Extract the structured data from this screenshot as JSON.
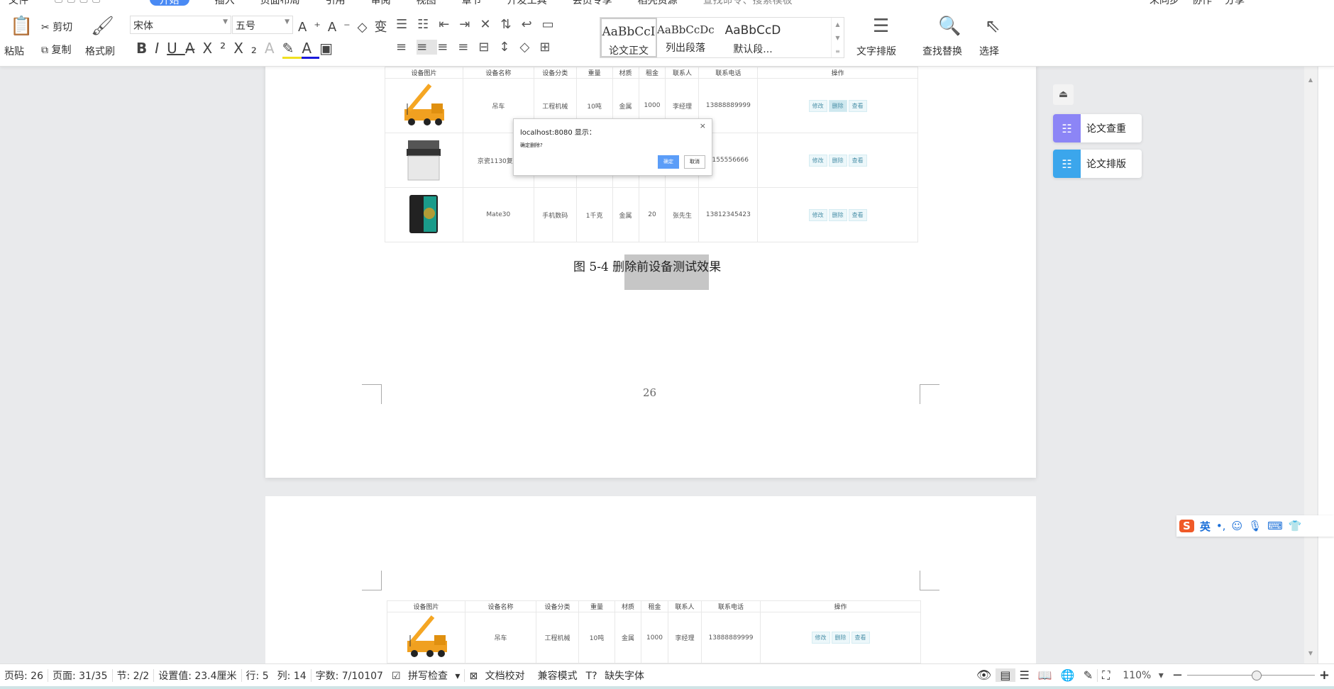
{
  "ribbon": {
    "tabs": [
      "文件",
      "开始",
      "插入",
      "页面布局",
      "引用",
      "审阅",
      "视图",
      "章节",
      "开发工具",
      "会员专享",
      "稻壳资源"
    ],
    "active_tab": "开始",
    "search_placeholder": "查找命令、搜索模板",
    "right": [
      "未同步",
      "协作",
      "分享"
    ],
    "clipboard": {
      "paste": "粘贴",
      "cut": "剪切",
      "copy": "复制",
      "format_painter": "格式刷"
    },
    "font": {
      "family": "宋体",
      "size": "五号"
    },
    "styles": [
      {
        "preview": "AaBbCcI",
        "label": "论文正文"
      },
      {
        "preview": "AaBbCcDc",
        "label": "列出段落"
      },
      {
        "preview": "AaBbCcD",
        "label": "默认段..."
      }
    ],
    "text_layout": "文字排版",
    "find_replace": "查找替换",
    "select": "选择"
  },
  "table": {
    "headers": [
      "设备图片",
      "设备名称",
      "设备分类",
      "重量",
      "材质",
      "租金",
      "联系人",
      "联系电话",
      "操作"
    ],
    "rows": [
      {
        "image": "crane",
        "name": "吊车",
        "category": "工程机械",
        "weight": "10吨",
        "material": "金属",
        "rent": "1000",
        "contact": "李经理",
        "phone": "13888889999"
      },
      {
        "image": "copier",
        "name": "京瓷1130复印",
        "category": "",
        "weight": "",
        "material": "",
        "rent": "",
        "contact": "",
        "phone": "5155556666"
      },
      {
        "image": "phone",
        "name": "Mate30",
        "category": "手机数码",
        "weight": "1千克",
        "material": "金属",
        "rent": "20",
        "contact": "张先生",
        "phone": "13812345423"
      }
    ],
    "actions": [
      "修改",
      "删除",
      "查看"
    ]
  },
  "dialog": {
    "title": "localhost:8080 显示：",
    "message": "确定删除?",
    "ok": "确定",
    "cancel": "取消",
    "close": "×"
  },
  "caption": {
    "prefix": "图 5-4 删",
    "highlighted": "除前设备测试效",
    "suffix": "果"
  },
  "page_number": "26",
  "side_panel": {
    "check": "论文查重",
    "layout": "论文排版"
  },
  "ime": {
    "lang": "英"
  },
  "status": {
    "page": "页码: 26",
    "pages": "页面: 31/35",
    "section": "节: 2/2",
    "setting": "设置值: 23.4厘米",
    "row": "行: 5",
    "col": "列: 14",
    "words": "字数: 7/10107",
    "spell": "拼写检查",
    "proof": "文档校对",
    "compat": "兼容模式",
    "missing_font": "缺失字体",
    "zoom": "110%",
    "zoom_level": 0.55
  },
  "colors": {
    "accent": "#4a8af4",
    "check": "#8c85f6",
    "layout": "#3ba6ec",
    "ok": "#5b9df8"
  }
}
